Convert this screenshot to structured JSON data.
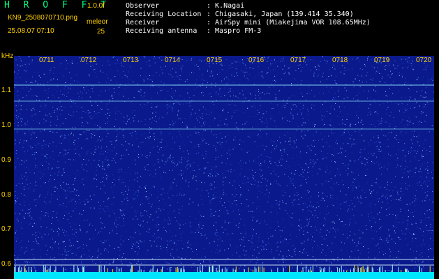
{
  "header": {
    "app_title": "H R O F F T",
    "version": "1.0.0f",
    "filename": "KN9_2508070710.png",
    "mode": "meleor",
    "datetime": "25.08.07 07:10",
    "count": "25"
  },
  "info": [
    {
      "label": "Observer",
      "value": ": K.Nagai"
    },
    {
      "label": "Receiving Location",
      "value": ": Chigasaki, Japan (139.414 35.340)"
    },
    {
      "label": "Receiver",
      "value": ": AirSpy mini (Miakejima VOR 108.65MHz)"
    },
    {
      "label": "Receiving antenna",
      "value": ": Maspro FM-3"
    }
  ],
  "spectrogram": {
    "y_unit": "kHz",
    "y_ticks": [
      "1.1",
      "1.0",
      "0.9",
      "0.8",
      "0.7",
      "0.6"
    ],
    "x_ticks": [
      "0711",
      "0712",
      "0713",
      "0714",
      "0715",
      "0716",
      "0717",
      "0718",
      "0719",
      "0720"
    ],
    "colors": {
      "background": "#0a1a8c",
      "line": "#8ee8ff",
      "bottom_band": "#00e5ff",
      "tick_text": "#ffd000"
    }
  }
}
